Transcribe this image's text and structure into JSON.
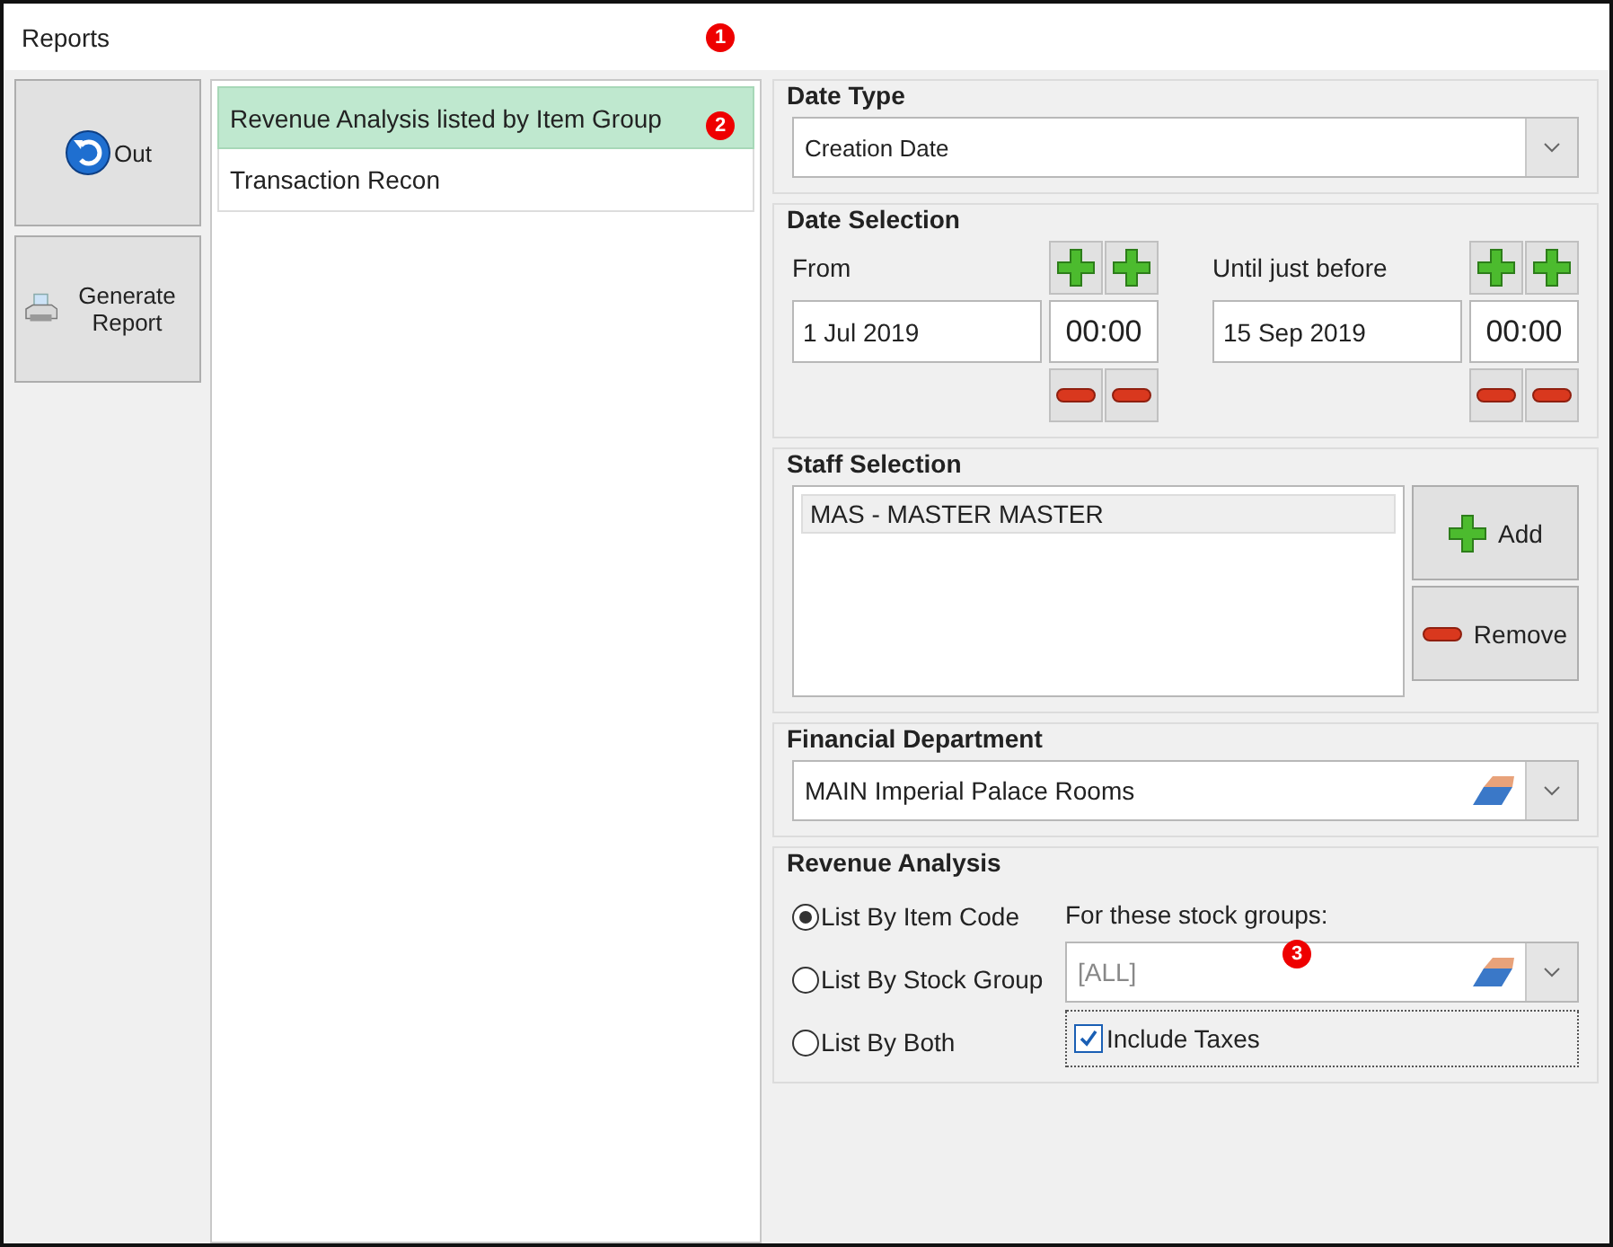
{
  "window": {
    "title": "Reports"
  },
  "actions": [
    {
      "label": "Out",
      "kind": "back"
    },
    {
      "label": "Generate Report",
      "kind": "print"
    }
  ],
  "reports": [
    {
      "label": "Revenue Analysis listed by Item Group",
      "selected": true
    },
    {
      "label": "Transaction Recon",
      "selected": false
    }
  ],
  "date_type": {
    "title": "Date Type",
    "value": "Creation Date"
  },
  "date_selection": {
    "title": "Date Selection",
    "ranges": [
      {
        "label": "From",
        "date": "1 Jul 2019",
        "time": "00:00"
      },
      {
        "label": "Until just before",
        "date": "15 Sep 2019",
        "time": "00:00"
      }
    ]
  },
  "staff_selection": {
    "title": "Staff Selection",
    "items": [
      {
        "label": "MAS - MASTER MASTER",
        "selected": true
      }
    ],
    "buttons": [
      {
        "label": "Add",
        "kind": "add"
      },
      {
        "label": "Remove",
        "kind": "remove"
      }
    ]
  },
  "financial_department": {
    "title": "Financial Department",
    "value": "MAIN Imperial Palace Rooms"
  },
  "revenue_analysis": {
    "title": "Revenue Analysis",
    "options": [
      {
        "label": "List By Item Code",
        "selected": true
      },
      {
        "label": "List By Stock Group",
        "selected": false
      },
      {
        "label": "List By Both",
        "selected": false
      }
    ],
    "stock_groups_label": "For these stock groups:",
    "stock_groups_value": "[ALL]",
    "include_taxes": {
      "label": "Include Taxes",
      "checked": true
    }
  },
  "markers": [
    "1",
    "2",
    "3"
  ]
}
